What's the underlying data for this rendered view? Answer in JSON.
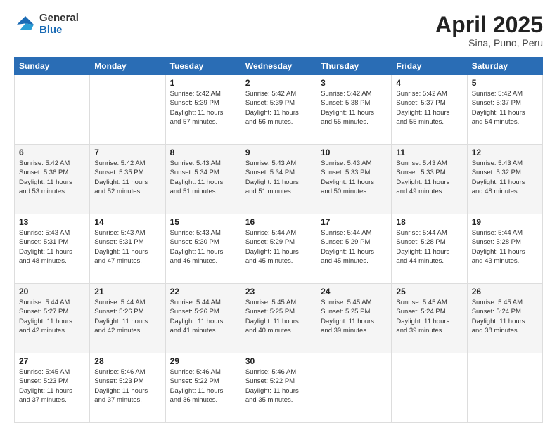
{
  "header": {
    "logo_general": "General",
    "logo_blue": "Blue",
    "title": "April 2025",
    "location": "Sina, Puno, Peru"
  },
  "days_of_week": [
    "Sunday",
    "Monday",
    "Tuesday",
    "Wednesday",
    "Thursday",
    "Friday",
    "Saturday"
  ],
  "weeks": [
    [
      {
        "day": "",
        "info": ""
      },
      {
        "day": "",
        "info": ""
      },
      {
        "day": "1",
        "info": "Sunrise: 5:42 AM\nSunset: 5:39 PM\nDaylight: 11 hours and 57 minutes."
      },
      {
        "day": "2",
        "info": "Sunrise: 5:42 AM\nSunset: 5:39 PM\nDaylight: 11 hours and 56 minutes."
      },
      {
        "day": "3",
        "info": "Sunrise: 5:42 AM\nSunset: 5:38 PM\nDaylight: 11 hours and 55 minutes."
      },
      {
        "day": "4",
        "info": "Sunrise: 5:42 AM\nSunset: 5:37 PM\nDaylight: 11 hours and 55 minutes."
      },
      {
        "day": "5",
        "info": "Sunrise: 5:42 AM\nSunset: 5:37 PM\nDaylight: 11 hours and 54 minutes."
      }
    ],
    [
      {
        "day": "6",
        "info": "Sunrise: 5:42 AM\nSunset: 5:36 PM\nDaylight: 11 hours and 53 minutes."
      },
      {
        "day": "7",
        "info": "Sunrise: 5:42 AM\nSunset: 5:35 PM\nDaylight: 11 hours and 52 minutes."
      },
      {
        "day": "8",
        "info": "Sunrise: 5:43 AM\nSunset: 5:34 PM\nDaylight: 11 hours and 51 minutes."
      },
      {
        "day": "9",
        "info": "Sunrise: 5:43 AM\nSunset: 5:34 PM\nDaylight: 11 hours and 51 minutes."
      },
      {
        "day": "10",
        "info": "Sunrise: 5:43 AM\nSunset: 5:33 PM\nDaylight: 11 hours and 50 minutes."
      },
      {
        "day": "11",
        "info": "Sunrise: 5:43 AM\nSunset: 5:33 PM\nDaylight: 11 hours and 49 minutes."
      },
      {
        "day": "12",
        "info": "Sunrise: 5:43 AM\nSunset: 5:32 PM\nDaylight: 11 hours and 48 minutes."
      }
    ],
    [
      {
        "day": "13",
        "info": "Sunrise: 5:43 AM\nSunset: 5:31 PM\nDaylight: 11 hours and 48 minutes."
      },
      {
        "day": "14",
        "info": "Sunrise: 5:43 AM\nSunset: 5:31 PM\nDaylight: 11 hours and 47 minutes."
      },
      {
        "day": "15",
        "info": "Sunrise: 5:43 AM\nSunset: 5:30 PM\nDaylight: 11 hours and 46 minutes."
      },
      {
        "day": "16",
        "info": "Sunrise: 5:44 AM\nSunset: 5:29 PM\nDaylight: 11 hours and 45 minutes."
      },
      {
        "day": "17",
        "info": "Sunrise: 5:44 AM\nSunset: 5:29 PM\nDaylight: 11 hours and 45 minutes."
      },
      {
        "day": "18",
        "info": "Sunrise: 5:44 AM\nSunset: 5:28 PM\nDaylight: 11 hours and 44 minutes."
      },
      {
        "day": "19",
        "info": "Sunrise: 5:44 AM\nSunset: 5:28 PM\nDaylight: 11 hours and 43 minutes."
      }
    ],
    [
      {
        "day": "20",
        "info": "Sunrise: 5:44 AM\nSunset: 5:27 PM\nDaylight: 11 hours and 42 minutes."
      },
      {
        "day": "21",
        "info": "Sunrise: 5:44 AM\nSunset: 5:26 PM\nDaylight: 11 hours and 42 minutes."
      },
      {
        "day": "22",
        "info": "Sunrise: 5:44 AM\nSunset: 5:26 PM\nDaylight: 11 hours and 41 minutes."
      },
      {
        "day": "23",
        "info": "Sunrise: 5:45 AM\nSunset: 5:25 PM\nDaylight: 11 hours and 40 minutes."
      },
      {
        "day": "24",
        "info": "Sunrise: 5:45 AM\nSunset: 5:25 PM\nDaylight: 11 hours and 39 minutes."
      },
      {
        "day": "25",
        "info": "Sunrise: 5:45 AM\nSunset: 5:24 PM\nDaylight: 11 hours and 39 minutes."
      },
      {
        "day": "26",
        "info": "Sunrise: 5:45 AM\nSunset: 5:24 PM\nDaylight: 11 hours and 38 minutes."
      }
    ],
    [
      {
        "day": "27",
        "info": "Sunrise: 5:45 AM\nSunset: 5:23 PM\nDaylight: 11 hours and 37 minutes."
      },
      {
        "day": "28",
        "info": "Sunrise: 5:46 AM\nSunset: 5:23 PM\nDaylight: 11 hours and 37 minutes."
      },
      {
        "day": "29",
        "info": "Sunrise: 5:46 AM\nSunset: 5:22 PM\nDaylight: 11 hours and 36 minutes."
      },
      {
        "day": "30",
        "info": "Sunrise: 5:46 AM\nSunset: 5:22 PM\nDaylight: 11 hours and 35 minutes."
      },
      {
        "day": "",
        "info": ""
      },
      {
        "day": "",
        "info": ""
      },
      {
        "day": "",
        "info": ""
      }
    ]
  ]
}
